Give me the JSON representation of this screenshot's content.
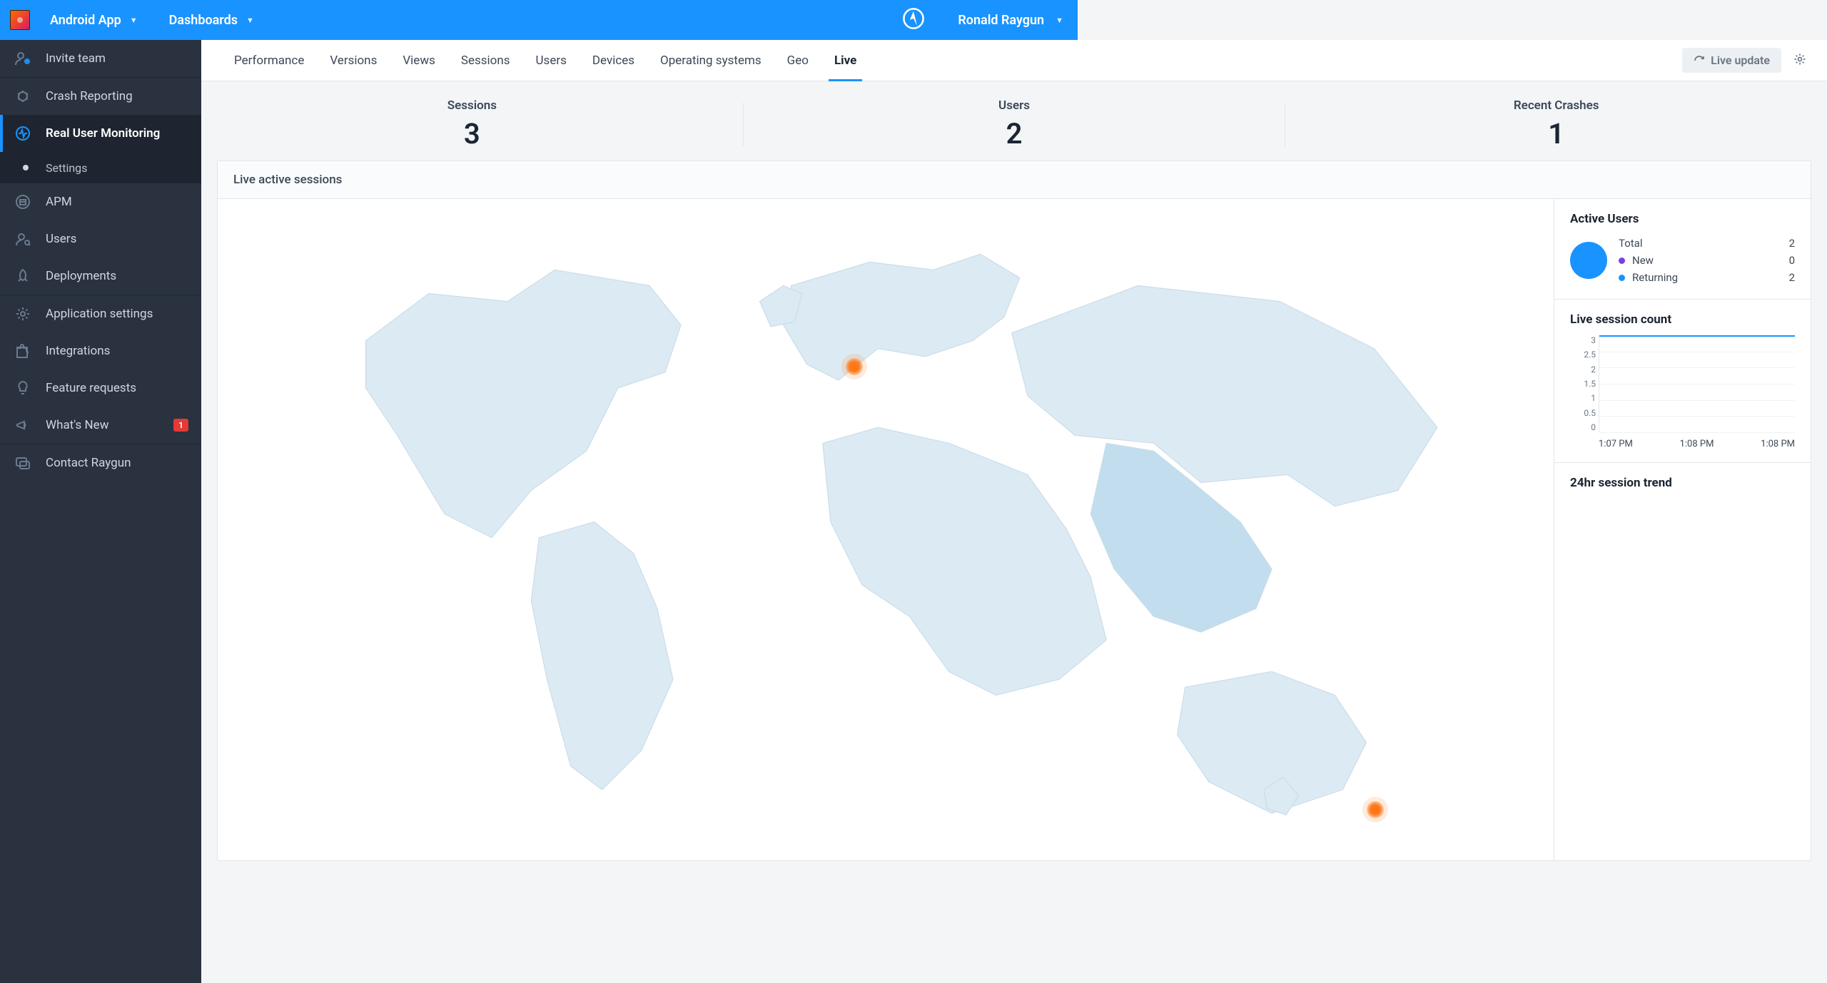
{
  "topbar": {
    "app_name": "Android App",
    "dashboards": "Dashboards",
    "user_name": "Ronald Raygun"
  },
  "sidebar": {
    "invite_team": "Invite team",
    "crash_reporting": "Crash Reporting",
    "rum": "Real User Monitoring",
    "rum_settings_sub": "Settings",
    "apm": "APM",
    "users": "Users",
    "deployments": "Deployments",
    "app_settings": "Application settings",
    "integrations": "Integrations",
    "feature_requests": "Feature requests",
    "whats_new": "What's New",
    "whats_new_badge": "1",
    "contact": "Contact Raygun"
  },
  "tabs": {
    "performance": "Performance",
    "versions": "Versions",
    "views": "Views",
    "sessions": "Sessions",
    "users": "Users",
    "devices": "Devices",
    "os": "Operating systems",
    "geo": "Geo",
    "live": "Live"
  },
  "live_update_label": "Live update",
  "kpis": {
    "sessions_label": "Sessions",
    "sessions_value": "3",
    "users_label": "Users",
    "users_value": "2",
    "crashes_label": "Recent Crashes",
    "crashes_value": "1"
  },
  "panel_title": "Live active sessions",
  "active_users": {
    "title": "Active Users",
    "total_label": "Total",
    "total_value": "2",
    "new_label": "New",
    "new_value": "0",
    "returning_label": "Returning",
    "returning_value": "2"
  },
  "session_count": {
    "title": "Live session count",
    "yticks": [
      "3",
      "2.5",
      "2",
      "1.5",
      "1",
      "0.5",
      "0"
    ],
    "xticks": [
      "1:07 PM",
      "1:08 PM",
      "1:08 PM"
    ]
  },
  "trend_title": "24hr session trend",
  "chart_data": {
    "type": "line",
    "title": "Live session count",
    "x": [
      "1:07 PM",
      "1:08 PM",
      "1:08 PM"
    ],
    "series": [
      {
        "name": "sessions",
        "values": [
          3,
          3,
          3
        ]
      }
    ],
    "xlabel": "",
    "ylabel": "",
    "ylim": [
      0,
      3
    ]
  },
  "colors": {
    "brand": "#1993ff",
    "new_dot": "#7b3fe4",
    "returning_dot": "#1993ff"
  }
}
